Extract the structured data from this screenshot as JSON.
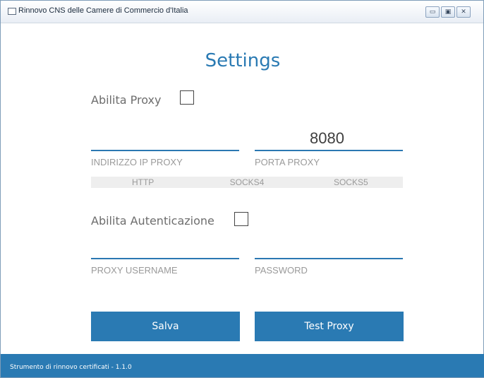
{
  "window": {
    "title": "Rinnovo CNS delle Camere di Commercio d'Italia"
  },
  "page": {
    "title": "Settings"
  },
  "proxy": {
    "enable_label": "Abilita Proxy",
    "ip_label": "INDIRIZZO IP PROXY",
    "port_label": "PORTA PROXY",
    "port_value": "8080",
    "types": [
      "HTTP",
      "SOCKS4",
      "SOCKS5"
    ]
  },
  "auth": {
    "enable_label": "Abilita Autenticazione",
    "username_label": "PROXY USERNAME",
    "password_label": "PASSWORD"
  },
  "buttons": {
    "save": "Salva",
    "test": "Test Proxy"
  },
  "status": {
    "text": "Strumento di rinnovo certificati - 1.1.0"
  },
  "colors": {
    "accent": "#2a7ab3"
  }
}
